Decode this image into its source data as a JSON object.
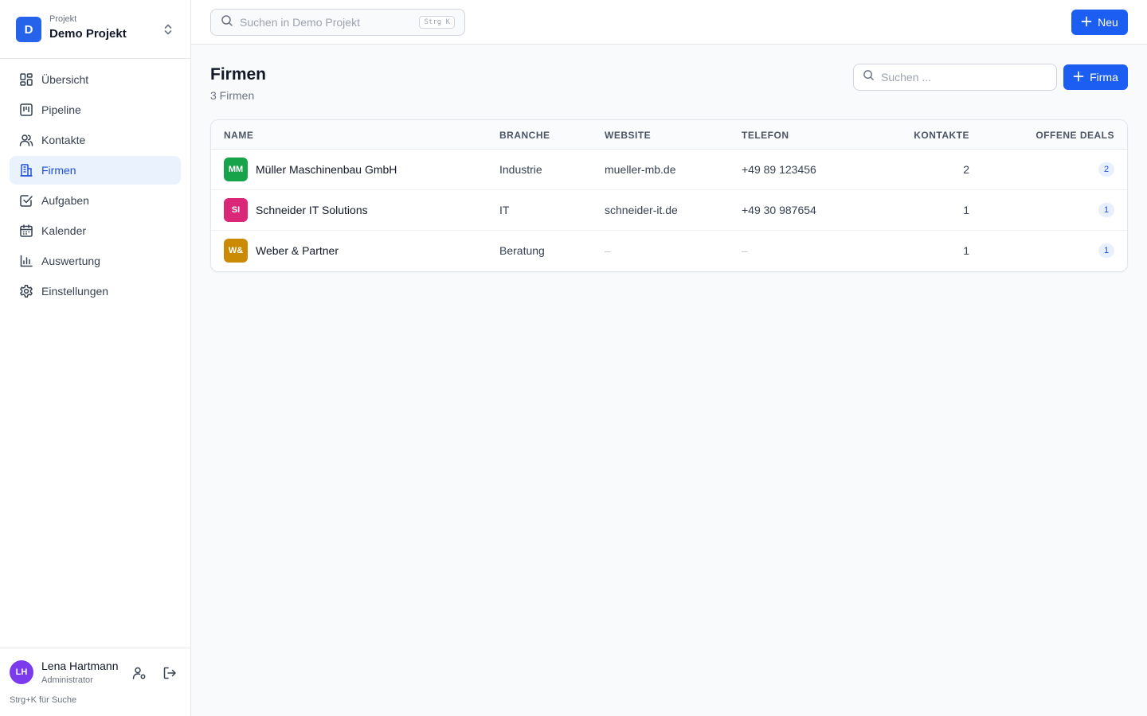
{
  "project": {
    "kicker": "Projekt",
    "name": "Demo Projekt",
    "badge": "D"
  },
  "nav": [
    {
      "label": "Übersicht",
      "icon": "grid-icon"
    },
    {
      "label": "Pipeline",
      "icon": "kanban-icon"
    },
    {
      "label": "Kontakte",
      "icon": "users-icon"
    },
    {
      "label": "Firmen",
      "icon": "building-icon",
      "active": true
    },
    {
      "label": "Aufgaben",
      "icon": "checkbox-icon"
    },
    {
      "label": "Kalender",
      "icon": "calendar-icon"
    },
    {
      "label": "Auswertung",
      "icon": "bar-chart-icon"
    },
    {
      "label": "Einstellungen",
      "icon": "gear-icon"
    }
  ],
  "user": {
    "initials": "LH",
    "name": "Lena Hartmann",
    "role": "Administrator",
    "hint": "Strg+K für Suche"
  },
  "topbar": {
    "search_placeholder": "Suchen in Demo Projekt",
    "shortcut": "Strg K",
    "new_label": "Neu"
  },
  "page": {
    "title": "Firmen",
    "subtitle": "3 Firmen",
    "search_placeholder": "Suchen ...",
    "add_label": "Firma"
  },
  "table": {
    "headers": [
      "NAME",
      "BRANCHE",
      "WEBSITE",
      "TELEFON",
      "KONTAKTE",
      "OFFENE DEALS"
    ],
    "rows": [
      {
        "initials": "MM",
        "color": "#16a34a",
        "name": "Müller Maschinenbau GmbH",
        "branche": "Industrie",
        "website": "mueller-mb.de",
        "telefon": "+49 89 123456",
        "kontakte": "2",
        "deals": "2"
      },
      {
        "initials": "SI",
        "color": "#db2777",
        "name": "Schneider IT Solutions",
        "branche": "IT",
        "website": "schneider-it.de",
        "telefon": "+49 30 987654",
        "kontakte": "1",
        "deals": "1"
      },
      {
        "initials": "W&",
        "color": "#ca8a04",
        "name": "Weber & Partner",
        "branche": "Beratung",
        "website": "–",
        "telefon": "–",
        "kontakte": "1",
        "deals": "1"
      }
    ]
  },
  "colors": {
    "primary": "#1d5ef2",
    "active_bg": "#eaf2fe",
    "avatar": "#7c3aed"
  }
}
